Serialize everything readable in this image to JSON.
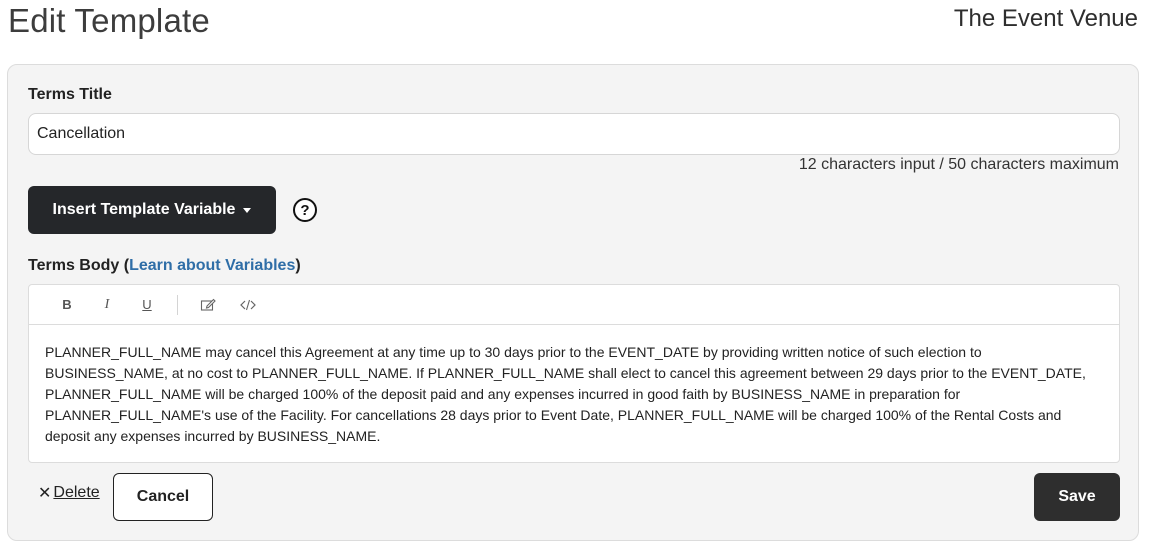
{
  "header": {
    "title": "Edit Template",
    "venue": "The Event Venue"
  },
  "form": {
    "title_label": "Terms Title",
    "title_value": "Cancellation",
    "char_count": "12 characters input / 50 characters maximum",
    "insert_variable_label": "Insert Template Variable",
    "help_symbol": "?",
    "body_label_prefix": "Terms Body (",
    "body_label_link": "Learn about Variables",
    "body_label_suffix": ")",
    "toolbar": {
      "bold": "B",
      "italic": "I",
      "underline": "U",
      "edit_icon": "edit-icon",
      "code_icon": "code-icon"
    },
    "body_text": "PLANNER_FULL_NAME may cancel this Agreement at any time up to 30 days prior to the EVENT_DATE by providing written notice of such election to BUSINESS_NAME, at no cost to PLANNER_FULL_NAME. If PLANNER_FULL_NAME shall elect to cancel this agreement between 29 days prior to the EVENT_DATE, PLANNER_FULL_NAME will be charged 100% of the deposit paid and any expenses incurred in good faith by BUSINESS_NAME in preparation for PLANNER_FULL_NAME's use of the Facility. For cancellations 28 days prior to Event Date, PLANNER_FULL_NAME will be charged 100% of the Rental Costs and deposit any expenses incurred by BUSINESS_NAME."
  },
  "actions": {
    "delete_label": "Delete",
    "delete_symbol": "✕",
    "cancel_label": "Cancel",
    "save_label": "Save"
  }
}
